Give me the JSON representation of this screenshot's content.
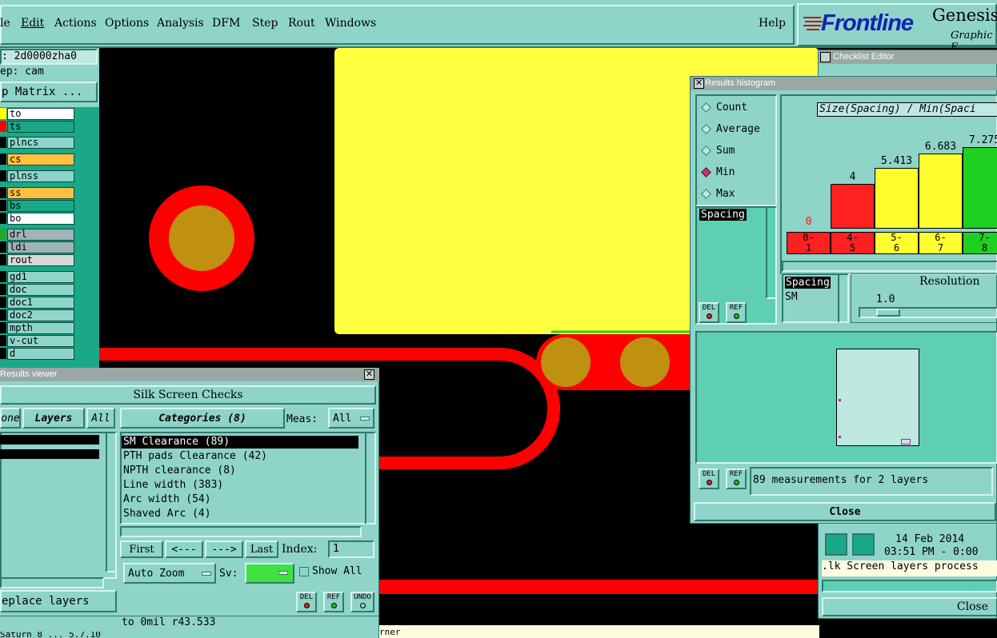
{
  "menu": {
    "items": [
      "le",
      "Edit",
      "Actions",
      "Options",
      "Analysis",
      "DFM",
      "Step",
      "Rout",
      "Windows"
    ],
    "help": "Help"
  },
  "brand": {
    "logo_text": "Frontline",
    "product": "Genesis",
    "subtitle": "Graphic E"
  },
  "job": {
    "job_line": ": 2d0000zha0",
    "step_line": "ep: cam",
    "matrix_button": "p Matrix ..."
  },
  "layers": [
    {
      "name": "to",
      "color": "#ffff00",
      "bg": "#ffffff"
    },
    {
      "name": "ts",
      "color": "#ff0000",
      "bg": "#1aa888"
    },
    {
      "name": "plncs",
      "color": "#000000",
      "bg": "#8fd4c8"
    },
    {
      "name": "cs",
      "color": "#000000",
      "bg": "#ffc040"
    },
    {
      "name": "plnss",
      "color": "#000000",
      "bg": "#8fd4c8"
    },
    {
      "name": "ss",
      "color": "#000000",
      "bg": "#ffc040"
    },
    {
      "name": "bs",
      "color": "#000000",
      "bg": "#1aa888"
    },
    {
      "name": "bo",
      "color": "#000000",
      "bg": "#ffffff"
    },
    {
      "name": "drl",
      "color": "#22aa22",
      "bg": "#9fb4b8"
    },
    {
      "name": "ldi",
      "color": "#000000",
      "bg": "#9fb4b8"
    },
    {
      "name": "rout",
      "color": "#000000",
      "bg": "#d8d8d8"
    },
    {
      "name": "gd1",
      "color": "#000000",
      "bg": "#8fd4c8"
    },
    {
      "name": "doc",
      "color": "#000000",
      "bg": "#8fd4c8"
    },
    {
      "name": "doc1",
      "color": "#000000",
      "bg": "#8fd4c8"
    },
    {
      "name": "doc2",
      "color": "#000000",
      "bg": "#8fd4c8"
    },
    {
      "name": "mpth",
      "color": "#000000",
      "bg": "#8fd4c8"
    },
    {
      "name": "v-cut",
      "color": "#000000",
      "bg": "#8fd4c8"
    },
    {
      "name": "d",
      "color": "#000000",
      "bg": "#8fd4c8"
    }
  ],
  "results_viewer": {
    "title": "Results viewer",
    "close_glyph": "✕",
    "header": "Silk Screen Checks",
    "tab_none": "one",
    "tab_layers": "Layers",
    "tab_all": "All",
    "categories_label": "Categories (8)",
    "meas_label": "Meas:",
    "meas_value": "All",
    "categories": [
      "SM Clearance (89)",
      "PTH pads Clearance (42)",
      "NPTH clearance (8)",
      "Line width (383)",
      "Arc width (54)",
      "Shaved Arc (4)"
    ],
    "nav": {
      "first": "First",
      "prev": "<---",
      "next": "--->",
      "last": "Last",
      "index_label": "Index:",
      "index_value": "1"
    },
    "auto_zoom": "Auto Zoom",
    "sv_label": "Sv:",
    "show_all": "Show All",
    "replace_layers": "eplace layers",
    "del": "DEL",
    "ref": "REF",
    "undo": "UNDO",
    "status": "to 0mil  r43.533",
    "bottom_text": "Saturn 8  ... 5.7.10"
  },
  "histogram": {
    "title": "Results histogram",
    "modes": [
      "Count",
      "Average",
      "Sum",
      "Min",
      "Max"
    ],
    "selected_mode": "Min",
    "chart_title": "Size(Spacing) / Min(Spaci",
    "list_item": "Spacing",
    "selection": [
      "Spacing",
      "SM"
    ],
    "resolution_label": "Resolution",
    "resolution_value": "1.0",
    "measurements": "89 measurements for 2 layers",
    "close": "Close",
    "del": "DEL",
    "ref": "REF"
  },
  "chart_data": {
    "type": "bar",
    "title": "Size(Spacing) / Min(Spaci",
    "categories": [
      "0-1",
      "4-5",
      "5-6",
      "6-7",
      "7-8"
    ],
    "values": [
      0,
      4,
      5.413,
      6.683,
      7.275
    ],
    "value_labels": [
      "0",
      "4",
      "5.413",
      "6.683",
      "7.275"
    ],
    "bin_top": [
      "0-",
      "4-",
      "5-",
      "6-",
      "7-"
    ],
    "bin_bottom": [
      "1",
      "5",
      "6",
      "7",
      "8"
    ],
    "colors": [
      "#ff2020",
      "#ff2020",
      "#ffff30",
      "#ffff30",
      "#20d020"
    ],
    "ylim": [
      0,
      8
    ]
  },
  "checklist": {
    "title": "Checklist Editor",
    "date": "14 Feb 2014",
    "time": "03:51 PM - 0:00",
    "status": ".lk Screen layers process",
    "close": "Close"
  },
  "canvas": {
    "footer_text": "rner",
    "colors": {
      "yellow": "#ffff40",
      "red": "#ff0000",
      "pad": "#c09010",
      "black": "#000000"
    }
  }
}
